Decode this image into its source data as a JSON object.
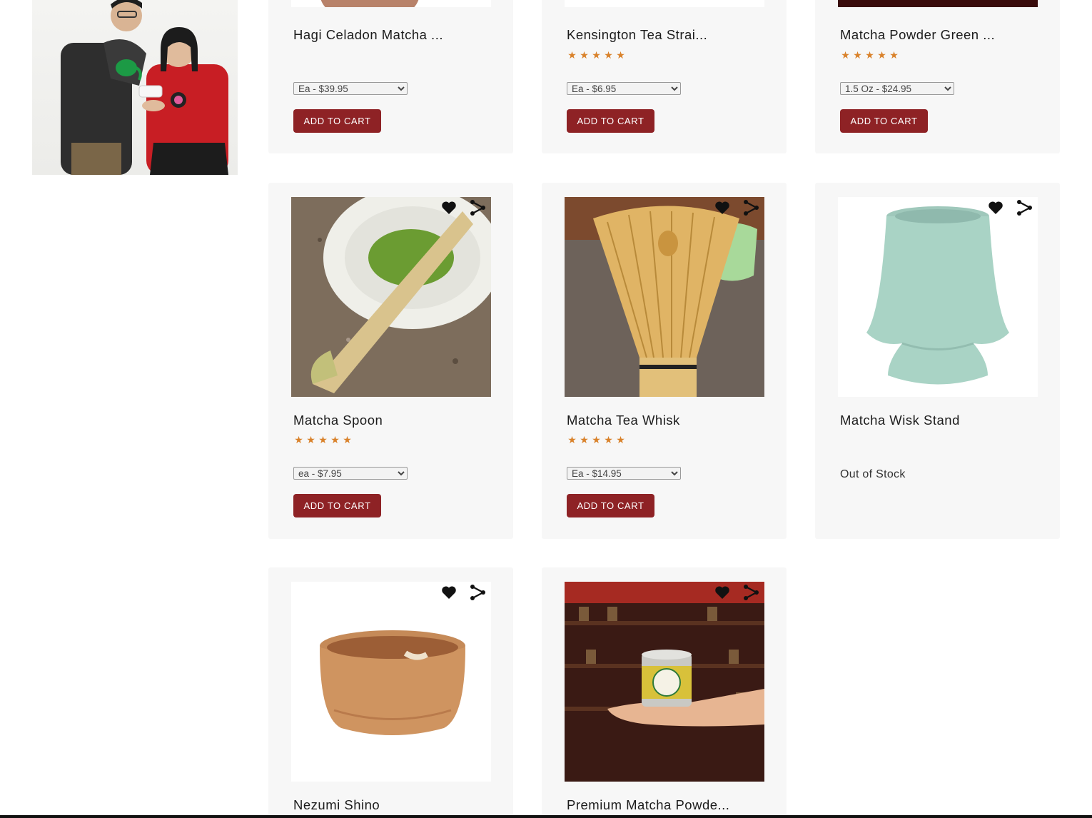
{
  "colors": {
    "accent": "#8e2225",
    "star": "#d9822b",
    "card_bg": "#f7f7f7"
  },
  "icons": {
    "wishlist": "heart-icon",
    "share": "share-icon",
    "rating": "star-icon"
  },
  "products": [
    {
      "title": "Hagi Celadon Matcha ...",
      "rating": 0,
      "option": "Ea - $39.95",
      "button": "ADD TO CART"
    },
    {
      "title": "Kensington Tea Strai...",
      "rating": 5,
      "option": "Ea - $6.95",
      "button": "ADD TO CART"
    },
    {
      "title": "Matcha Powder Green ...",
      "rating": 5,
      "option": "1.5 Oz - $24.95",
      "button": "ADD TO CART"
    },
    {
      "title": "Matcha Spoon",
      "rating": 5,
      "option": "ea - $7.95",
      "button": "ADD TO CART"
    },
    {
      "title": "Matcha Tea Whisk",
      "rating": 5,
      "option": "Ea - $14.95",
      "button": "ADD TO CART"
    },
    {
      "title": "Matcha Wisk Stand",
      "rating": 0,
      "status": "Out of Stock"
    },
    {
      "title": "Nezumi Shino"
    },
    {
      "title": "Premium Matcha Powde..."
    }
  ]
}
